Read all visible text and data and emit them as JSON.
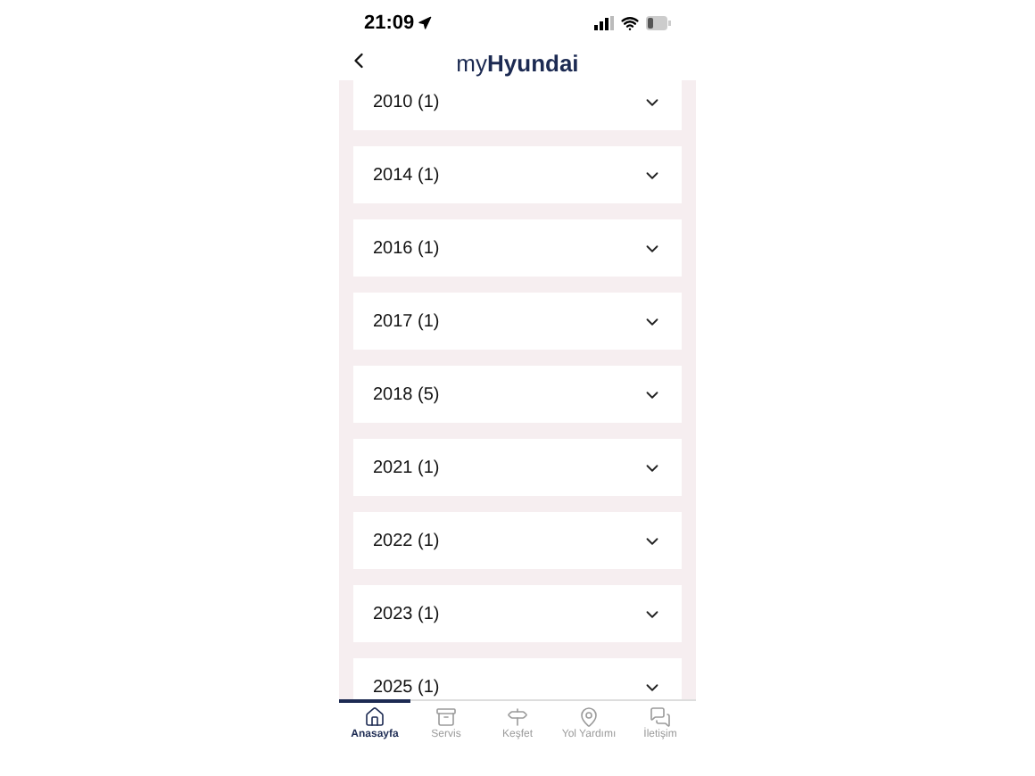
{
  "status_bar": {
    "time": "21:09"
  },
  "header": {
    "title": "my**Hyundai**"
  },
  "years": [
    {
      "label": "2010 (1)",
      "expanded": false
    },
    {
      "label": "2014 (1)",
      "expanded": false
    },
    {
      "label": "2016 (1)",
      "expanded": false
    },
    {
      "label": "2017 (1)",
      "expanded": false
    },
    {
      "label": "2018 (5)",
      "expanded": false
    },
    {
      "label": "2021 (1)",
      "expanded": false
    },
    {
      "label": "2022 (1)",
      "expanded": false
    },
    {
      "label": "2023 (1)",
      "expanded": false
    },
    {
      "label": "2025 (1)",
      "expanded": false
    }
  ],
  "tab_bar": [
    {
      "label": "Anasayfa",
      "selected": true
    },
    {
      "label": "Servis",
      "selected": false
    },
    {
      "label": "Keşfet",
      "selected": false
    },
    {
      "label": "Yol Yardımı",
      "selected": false
    },
    {
      "label": "İletişim",
      "selected": false
    }
  ]
}
